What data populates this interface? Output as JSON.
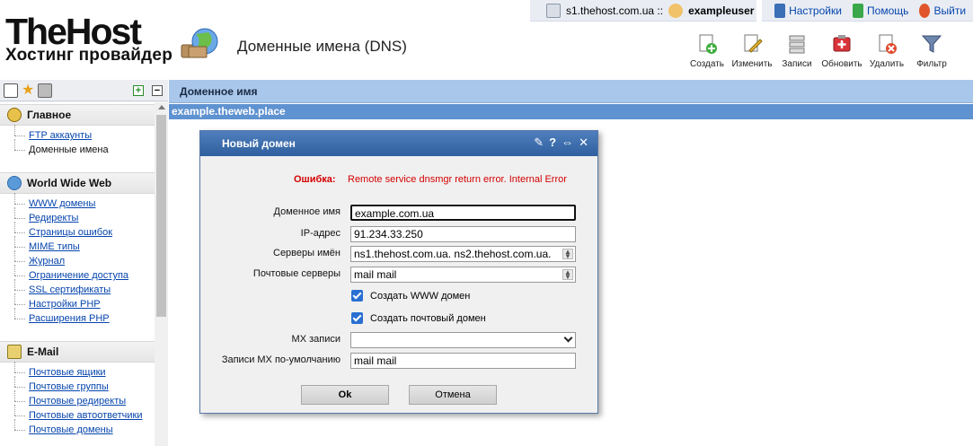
{
  "header": {
    "logo_main": "TheHost",
    "logo_sub": "Хостинг провайдер",
    "page_title": "Доменные имена (DNS)"
  },
  "topbar": {
    "server": "s1.thehost.com.ua ::",
    "user": "exampleuser",
    "links": [
      "Настройки",
      "Помощь",
      "Выйти"
    ]
  },
  "toolbar": {
    "items": [
      "Создать",
      "Изменить",
      "Записи",
      "Обновить",
      "Удалить",
      "Фильтр"
    ]
  },
  "sidebar": {
    "groups": [
      {
        "title": "Главное",
        "items": [
          {
            "label": "FTP аккаунты",
            "link": true
          },
          {
            "label": "Доменные имена",
            "link": false
          }
        ]
      },
      {
        "title": "World Wide Web",
        "items": [
          {
            "label": "WWW домены",
            "link": true
          },
          {
            "label": "Редиректы",
            "link": true
          },
          {
            "label": "Страницы ошибок",
            "link": true
          },
          {
            "label": "MIME типы",
            "link": true
          },
          {
            "label": "Журнал",
            "link": true
          },
          {
            "label": "Ограничение доступа",
            "link": true
          },
          {
            "label": "SSL сертификаты",
            "link": true
          },
          {
            "label": "Настройки PHP",
            "link": true
          },
          {
            "label": "Расширения PHP",
            "link": true
          }
        ]
      },
      {
        "title": "E-Mail",
        "items": [
          {
            "label": "Почтовые ящики",
            "link": true
          },
          {
            "label": "Почтовые группы",
            "link": true
          },
          {
            "label": "Почтовые редиректы",
            "link": true
          },
          {
            "label": "Почтовые автоответчики",
            "link": true
          },
          {
            "label": "Почтовые домены",
            "link": true
          }
        ]
      }
    ]
  },
  "main": {
    "column_header": "Доменное имя",
    "rows": [
      "example.theweb.place"
    ]
  },
  "dialog": {
    "title": "Новый домен",
    "error_label": "Ошибка:",
    "error_text": "Remote service dnsmgr return error. Internal Error",
    "domain_label": "Доменное имя",
    "domain_value": "example.com.ua",
    "ip_label": "IP-адрес",
    "ip_value": "91.234.33.250",
    "ns_label": "Серверы имён",
    "ns_value": "ns1.thehost.com.ua. ns2.thehost.com.ua.",
    "mail_label": "Почтовые серверы",
    "mail_value": "mail mail",
    "www_cb_label": "Создать WWW домен",
    "mail_cb_label": "Создать почтовый домен",
    "mx_label": "MX записи",
    "mx_value": "",
    "mx_default_label": "Записи MX по-умолчанию",
    "mx_default_value": "mail mail",
    "ok_label": "Ok",
    "cancel_label": "Отмена"
  },
  "colors": {
    "main_header_bg": "#a9c7ea",
    "selected_row_bg": "#5f92d0",
    "dialog_header_bg": "#3f6fae",
    "error_red": "#d40000",
    "link_blue": "#0645ad"
  }
}
